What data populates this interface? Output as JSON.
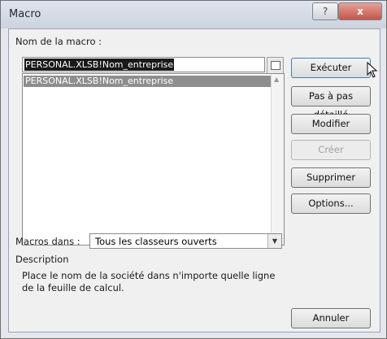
{
  "window": {
    "title": "Macro",
    "help_label": "?",
    "close_label": "x"
  },
  "name_label": "Nom de la macro :",
  "name_value": "PERSONAL.XLSB!Nom_entreprise",
  "list": {
    "selected": "PERSONAL.XLSB!Nom_entreprise"
  },
  "buttons": {
    "run": "Exécuter",
    "step": "Pas à pas détaillé",
    "modify": "Modifier",
    "create": "Créer",
    "delete": "Supprimer",
    "options": "Options...",
    "cancel": "Annuler"
  },
  "macros_in": {
    "label": "Macros dans :",
    "value": "Tous les classeurs ouverts"
  },
  "description": {
    "label": "Description",
    "text": "Place le nom de la société dans n'importe quelle ligne de la feuille de calcul."
  }
}
